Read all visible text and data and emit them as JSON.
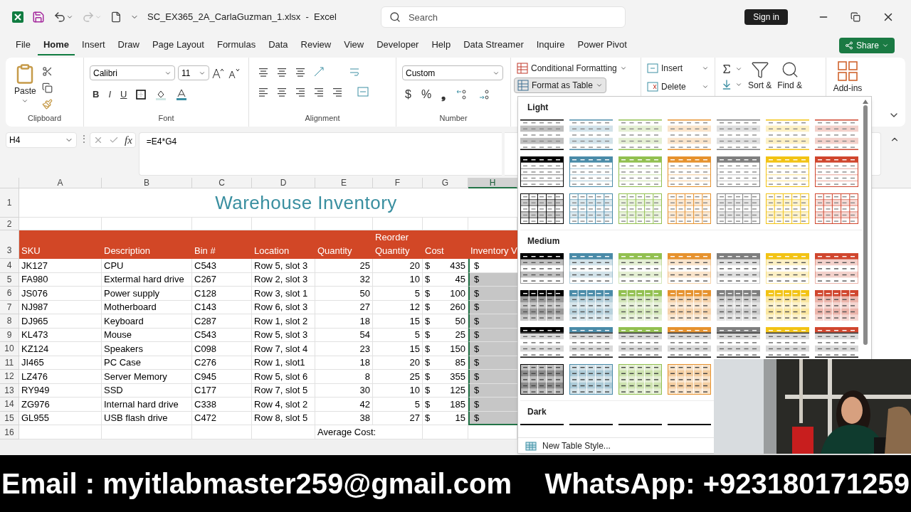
{
  "title_bar": {
    "document": "SC_EX365_2A_CarlaGuzman_1.xlsx  -  Excel",
    "search": {
      "placeholder": "Search"
    },
    "sign_in": "Sign in"
  },
  "menu_tabs": [
    {
      "label": "File",
      "selected": false
    },
    {
      "label": "Home",
      "selected": true
    },
    {
      "label": "Insert",
      "selected": false
    },
    {
      "label": "Draw",
      "selected": false
    },
    {
      "label": "Page Layout",
      "selected": false
    },
    {
      "label": "Formulas",
      "selected": false
    },
    {
      "label": "Data",
      "selected": false
    },
    {
      "label": "Review",
      "selected": false
    },
    {
      "label": "View",
      "selected": false
    },
    {
      "label": "Developer",
      "selected": false
    },
    {
      "label": "Help",
      "selected": false
    },
    {
      "label": "Data Streamer",
      "selected": false
    },
    {
      "label": "Inquire",
      "selected": false
    },
    {
      "label": "Power Pivot",
      "selected": false
    }
  ],
  "share": "Share",
  "ribbon": {
    "clipboard": {
      "paste": "Paste",
      "label": "Clipboard"
    },
    "font": {
      "name": "Calibri",
      "size": "11",
      "bold": "B",
      "italic": "I",
      "underline": "U",
      "label": "Font"
    },
    "alignment": {
      "label": "Alignment"
    },
    "number": {
      "format": "Custom",
      "currency": "$",
      "percent": "%",
      "comma": "❟",
      "label": "Number"
    },
    "styles": {
      "conditional": "Conditional Formatting",
      "format_table": {
        "label": "Format as Table",
        "open": true
      }
    },
    "cells": {
      "insert": "Insert",
      "delete": "Delete"
    },
    "editing": {
      "sort": "Sort &",
      "find": "Find &"
    },
    "addins": "Add-ins"
  },
  "formula_bar": {
    "cell": "H4",
    "more": "⋮",
    "fx": "fx",
    "formula": "=E4*G4"
  },
  "sheet": {
    "columns": [
      {
        "label": "A",
        "selected": false
      },
      {
        "label": "B",
        "selected": false
      },
      {
        "label": "C",
        "selected": false
      },
      {
        "label": "D",
        "selected": false
      },
      {
        "label": "E",
        "selected": false
      },
      {
        "label": "F",
        "selected": false
      },
      {
        "label": "G",
        "selected": false
      },
      {
        "label": "H",
        "selected": true
      }
    ],
    "title_row": "1",
    "title": "Warehouse Inventory",
    "blank_row": "2",
    "header_row": "3",
    "header": [
      "SKU",
      "Description",
      "Bin #",
      "Location",
      "Quantity",
      "Reorder Quantity",
      "Cost",
      "Inventory V"
    ],
    "rows": [
      {
        "number": "4",
        "sku": "JK127",
        "description": "CPU",
        "bin": "C543",
        "location": "Row 5, slot 3",
        "quantity": "25",
        "reorder": "20",
        "cost_symbol": "$",
        "cost": "435",
        "value_symbol": "$",
        "selected": true,
        "active": true
      },
      {
        "number": "5",
        "sku": "FA980",
        "description": "Extermal hard drive",
        "bin": "C267",
        "location": "Row 2, slot 3",
        "quantity": "32",
        "reorder": "10",
        "cost_symbol": "$",
        "cost": "45",
        "value_symbol": "$",
        "selected": true,
        "active": false
      },
      {
        "number": "6",
        "sku": "JS076",
        "description": "Power supply",
        "bin": "C128",
        "location": "Row 3, slot 1",
        "quantity": "50",
        "reorder": "5",
        "cost_symbol": "$",
        "cost": "100",
        "value_symbol": "$",
        "selected": true,
        "active": false
      },
      {
        "number": "7",
        "sku": "NJ987",
        "description": "Motherboard",
        "bin": "C143",
        "location": "Row 6, slot 3",
        "quantity": "27",
        "reorder": "12",
        "cost_symbol": "$",
        "cost": "260",
        "value_symbol": "$",
        "selected": true,
        "active": false
      },
      {
        "number": "8",
        "sku": "DJ965",
        "description": "Keyboard",
        "bin": "C287",
        "location": "Row 1, slot 2",
        "quantity": "18",
        "reorder": "15",
        "cost_symbol": "$",
        "cost": "50",
        "value_symbol": "$",
        "selected": true,
        "active": false
      },
      {
        "number": "9",
        "sku": "KL473",
        "description": "Mouse",
        "bin": "C543",
        "location": "Row 5, slot 3",
        "quantity": "54",
        "reorder": "5",
        "cost_symbol": "$",
        "cost": "25",
        "value_symbol": "$",
        "selected": true,
        "active": false
      },
      {
        "number": "10",
        "sku": "KZ124",
        "description": "Speakers",
        "bin": "C098",
        "location": "Row 7, slot 4",
        "quantity": "23",
        "reorder": "15",
        "cost_symbol": "$",
        "cost": "150",
        "value_symbol": "$",
        "selected": true,
        "active": false
      },
      {
        "number": "11",
        "sku": "JI465",
        "description": "PC Case",
        "bin": "C276",
        "location": "Row 1, slot1",
        "quantity": "18",
        "reorder": "20",
        "cost_symbol": "$",
        "cost": "85",
        "value_symbol": "$",
        "selected": true,
        "active": false
      },
      {
        "number": "12",
        "sku": "LZ476",
        "description": "Server Memory",
        "bin": "C945",
        "location": "Row 5, slot 6",
        "quantity": "8",
        "reorder": "25",
        "cost_symbol": "$",
        "cost": "355",
        "value_symbol": "$",
        "selected": true,
        "active": false
      },
      {
        "number": "13",
        "sku": "RY949",
        "description": "SSD",
        "bin": "C177",
        "location": "Row 7, slot 5",
        "quantity": "30",
        "reorder": "10",
        "cost_symbol": "$",
        "cost": "125",
        "value_symbol": "$",
        "selected": true,
        "active": false
      },
      {
        "number": "14",
        "sku": "ZG976",
        "description": "Internal hard drive",
        "bin": "C338",
        "location": "Row 4, slot 2",
        "quantity": "42",
        "reorder": "5",
        "cost_symbol": "$",
        "cost": "185",
        "value_symbol": "$",
        "selected": true,
        "active": false
      },
      {
        "number": "15",
        "sku": "GL955",
        "description": "USB flash drive",
        "bin": "C472",
        "location": "Row 8, slot 5",
        "quantity": "38",
        "reorder": "27",
        "cost_symbol": "$",
        "cost": "15",
        "value_symbol": "$",
        "selected": true,
        "active": false
      }
    ],
    "footer_row": "16",
    "footer_label": "Average Cost:"
  },
  "gallery": {
    "sections": [
      {
        "title": "Light",
        "rows": [
          {
            "kind": "light-banded",
            "swatches": [
              {
                "color": "#000000"
              },
              {
                "color": "#4a8ba8"
              },
              {
                "color": "#92c050"
              },
              {
                "color": "#e6922e"
              },
              {
                "color": "#7f7f7f"
              },
              {
                "color": "#f2c314"
              },
              {
                "color": "#d0462e"
              }
            ]
          },
          {
            "kind": "light-header",
            "swatches": [
              {
                "color": "#000000"
              },
              {
                "color": "#4a8ba8"
              },
              {
                "color": "#92c050"
              },
              {
                "color": "#e6922e"
              },
              {
                "color": "#7f7f7f"
              },
              {
                "color": "#f2c314"
              },
              {
                "color": "#d0462e"
              }
            ]
          },
          {
            "kind": "light-grid",
            "swatches": [
              {
                "color": "#000000"
              },
              {
                "color": "#4a8ba8"
              },
              {
                "color": "#92c050"
              },
              {
                "color": "#e6922e"
              },
              {
                "color": "#7f7f7f"
              },
              {
                "color": "#f2c314"
              },
              {
                "color": "#d0462e"
              }
            ]
          }
        ]
      },
      {
        "title": "Medium",
        "rows": [
          {
            "kind": "medium-banded",
            "swatches": [
              {
                "color": "#000000"
              },
              {
                "color": "#4a8ba8"
              },
              {
                "color": "#92c050"
              },
              {
                "color": "#e6922e"
              },
              {
                "color": "#7f7f7f"
              },
              {
                "color": "#f2c314"
              },
              {
                "color": "#d0462e"
              }
            ]
          },
          {
            "kind": "medium-filled",
            "swatches": [
              {
                "color": "#000000"
              },
              {
                "color": "#4a8ba8"
              },
              {
                "color": "#92c050"
              },
              {
                "color": "#e6922e"
              },
              {
                "color": "#7f7f7f"
              },
              {
                "color": "#f2c314"
              },
              {
                "color": "#d0462e"
              }
            ]
          },
          {
            "kind": "medium-header-rule",
            "swatches": [
              {
                "color": "#000000"
              },
              {
                "color": "#4a8ba8"
              },
              {
                "color": "#92c050"
              },
              {
                "color": "#e6922e"
              },
              {
                "color": "#7f7f7f"
              },
              {
                "color": "#f2c314"
              },
              {
                "color": "#d0462e"
              }
            ]
          },
          {
            "kind": "medium-tinted",
            "swatches": [
              {
                "color": "#000000"
              },
              {
                "color": "#4a8ba8"
              },
              {
                "color": "#92c050"
              },
              {
                "color": "#e6922e"
              }
            ]
          }
        ]
      },
      {
        "title": "Dark",
        "rows": [
          {
            "kind": "dark-top",
            "swatches": [
              {
                "color": "#000000"
              },
              {
                "color": "#000000"
              },
              {
                "color": "#000000"
              },
              {
                "color": "#000000"
              }
            ]
          }
        ]
      }
    ],
    "new_style": "New Table Style..."
  },
  "banner": {
    "email": "Email : myitlabmaster259@gmail.com",
    "whatsapp": "WhatsApp: +923180171259"
  }
}
